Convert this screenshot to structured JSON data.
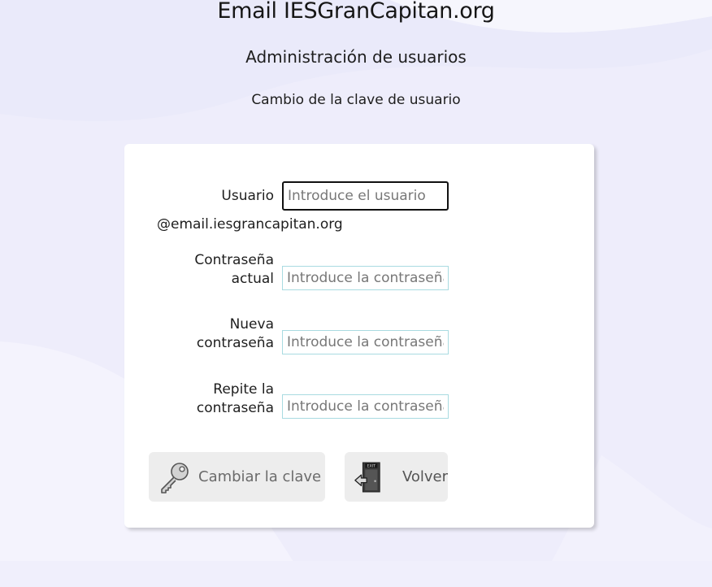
{
  "header": {
    "title": "Email IESGranCapitan.org",
    "subtitle": "Administración de usuarios",
    "section": "Cambio de la clave de usuario"
  },
  "form": {
    "usuario_label": "Usuario",
    "usuario_placeholder": "Introduce el usuario",
    "domain_suffix": "@email.iesgrancapitan.org",
    "current_label_line1": "Contraseña",
    "current_label_line2": "actual",
    "new_label_line1": "Nueva",
    "new_label_line2": "contraseña",
    "repeat_label_line1": "Repite la",
    "repeat_label_line2": "contraseña",
    "password_placeholder": "Introduce la contraseña"
  },
  "buttons": {
    "change": {
      "label": "Cambiar la clave",
      "icon": "key-icon"
    },
    "back": {
      "label": "Volver",
      "icon": "exit-door-icon"
    }
  },
  "colors": {
    "background": "#eeedfb",
    "card": "#ffffff",
    "input_border": "#a9dbe1",
    "button_bg": "#ededed"
  }
}
